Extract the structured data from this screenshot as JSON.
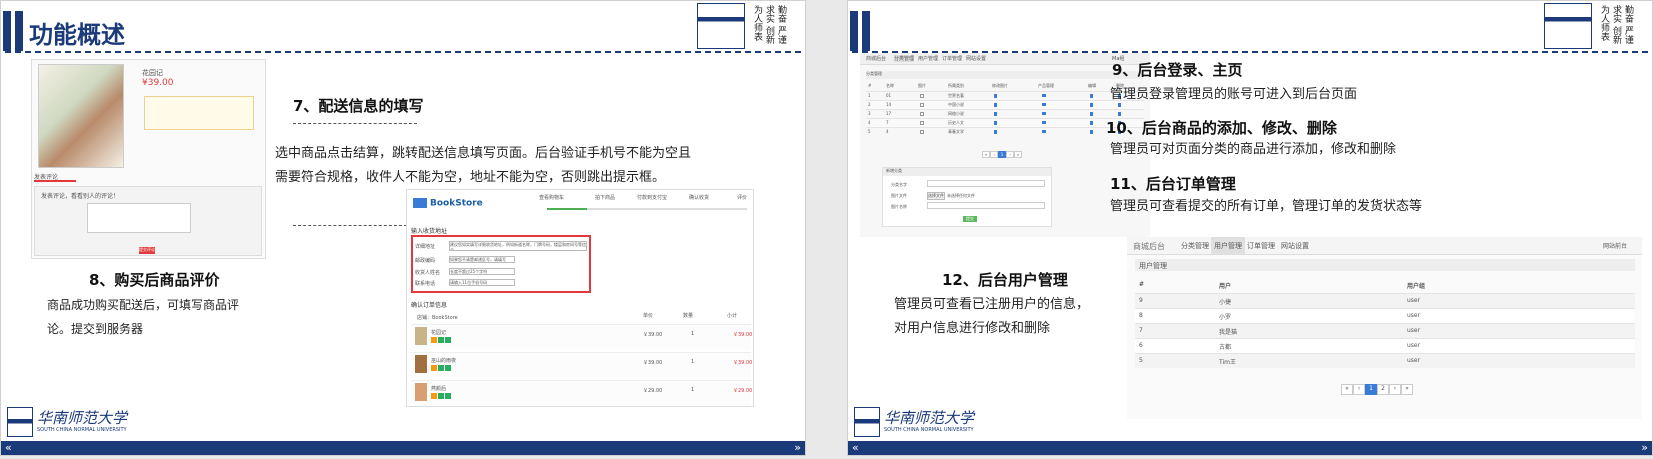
{
  "slide1": {
    "title": "功能概述",
    "heading7": "7、配送信息的填写",
    "dashes7": "------------------------------",
    "text7": "选中商品点击结算，跳转配送信息填写页面。后台验证手机号不能为空且需要符合规格，收件人不能为空，地址不能为空，否则跳出提示框。",
    "dashes7b": "--------------------------------",
    "heading8": "8、购买后商品评价",
    "text8": "商品成功购买配送后，可填写商品评论。提交到服务器",
    "crest_text": "勤奋 严谨 求实 创新 为人师表",
    "logo_cn": "华南师范大学",
    "logo_en": "SOUTH CHINA NORMAL UNIVERSITY",
    "product_shot": {
      "name": "花园记",
      "price": "39.00",
      "tab": "发表评论",
      "comment_prompt": "发表评论，看看别人的评论！",
      "submit": "提交评论"
    },
    "checkout_shot": {
      "brand": "BookStore",
      "steps": [
        "查看购物车",
        "拍下商品",
        "付款到支付宝",
        "确认收货",
        "评价"
      ],
      "address_title": "输入收货地址",
      "fields": [
        {
          "label": "详细地址",
          "value": "建议您如实填写详细收货地址，例如街道名称，门牌号码，楼层和房间号等信息"
        },
        {
          "label": "邮政编码",
          "value": "如果您不清楚邮递区号，请填写000000"
        },
        {
          "label": "收货人姓名",
          "value": "长度不超过25个字符"
        },
        {
          "label": "联系电话",
          "value": "请输入11位手机号码"
        }
      ],
      "order_title": "确认订单信息",
      "cols": [
        "单价",
        "数量",
        "小计"
      ],
      "shop": "店铺：BookStore",
      "items": [
        {
          "name": "花园记",
          "price": "￥39.00",
          "qty": "1",
          "sub": "￥39.00"
        },
        {
          "name": "巫山的雨夜",
          "price": "￥39.00",
          "qty": "1",
          "sub": "￥39.00"
        },
        {
          "name": "燕颜后",
          "price": "￥29.00",
          "qty": "1",
          "sub": "￥29.00"
        }
      ]
    }
  },
  "slide2": {
    "heading9": "9、后台登录、主页",
    "text9": "管理员登录管理员的账号可进入到后台页面",
    "heading10": "10、后台商品的添加、修改、删除",
    "text10": "管理员可对页面分类的商品进行添加，修改和删除",
    "heading11": "11、后台订单管理",
    "text11": "管理员可查看提交的所有订单，管理订单的发货状态等",
    "heading12": "12、后台用户管理",
    "text12": "管理员可查看已注册用户的信息，对用户信息进行修改和删除",
    "crest_text": "勤奋 严谨 求实 创新 为人师表",
    "logo_cn": "华南师范大学",
    "logo_en": "SOUTH CHINA NORMAL UNIVERSITY",
    "goods_shot": {
      "nav": [
        "商城后台",
        "分类管理",
        "用户管理",
        "订单管理",
        "网站设置"
      ],
      "right": "Ma组",
      "section": "分类管理",
      "cols": [
        "#",
        "名称",
        "图片",
        "所属类别",
        "修改图片",
        "产品管理",
        "编辑",
        "删除"
      ],
      "rows": [
        {
          "id": "1",
          "name": "01",
          "cat": "世界名著"
        },
        {
          "id": "2",
          "name": "14",
          "cat": "中国小说"
        },
        {
          "id": "3",
          "name": "17",
          "cat": "网络小说"
        },
        {
          "id": "4",
          "name": "7",
          "cat": "历史人文"
        },
        {
          "id": "5",
          "name": "4",
          "cat": "青春文学"
        }
      ],
      "pager": [
        "«",
        "‹",
        "1",
        "›",
        "»"
      ],
      "form_title": "新增分类",
      "form_fields": [
        "分类名字",
        "图片文件",
        "图片名称"
      ],
      "file_btn": "选择文件",
      "file_text": "未选择任何文件",
      "submit": "提交"
    },
    "users_shot": {
      "nav": [
        "商城后台",
        "分类管理",
        "用户管理",
        "订单管理",
        "网站设置"
      ],
      "right": "网站前台",
      "section": "用户管理",
      "cols": [
        "#",
        "用户",
        "用户组"
      ],
      "rows": [
        {
          "id": "9",
          "user": "小捷",
          "group": "user"
        },
        {
          "id": "8",
          "user": "小罗",
          "group": "user"
        },
        {
          "id": "7",
          "user": "我是猫",
          "group": "user"
        },
        {
          "id": "6",
          "user": "古都",
          "group": "user"
        },
        {
          "id": "5",
          "user": "Tim王",
          "group": "user"
        }
      ],
      "pager": [
        "«",
        "‹",
        "1",
        "2",
        "›",
        "»"
      ]
    }
  }
}
